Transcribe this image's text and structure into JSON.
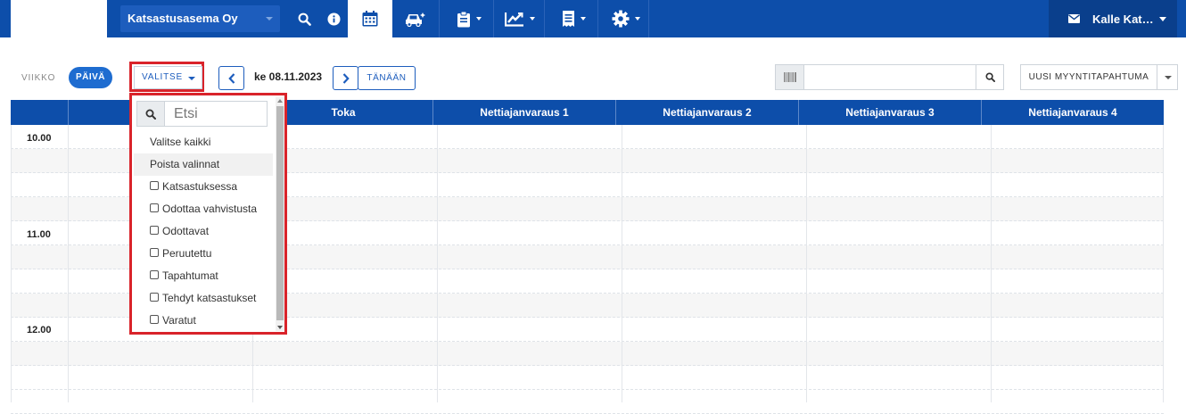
{
  "topbar": {
    "company": "Katsastusasema Oy",
    "user_name": "Kalle Kat…",
    "icons": [
      "search-icon",
      "info-icon",
      "calendar-icon",
      "car-icon",
      "clipboard-icon",
      "chart-icon",
      "receipt-icon",
      "gear-icon",
      "mail-icon"
    ]
  },
  "controls": {
    "week_label": "VIIKKO",
    "day_label": "PÄIVÄ",
    "select_label": "VALITSE",
    "date": "ke 08.11.2023",
    "today_label": "TÄNÄÄN",
    "search_value": "",
    "new_sale_label": "UUSI MYYNTITAPAHTUMA"
  },
  "calendar": {
    "columns": [
      "",
      "Toka",
      "Nettiajanvaraus 1",
      "Nettiajanvaraus 2",
      "Nettiajanvaraus 3",
      "Nettiajanvaraus 4"
    ],
    "times": [
      "10.00",
      "11.00",
      "12.00"
    ]
  },
  "dropdown": {
    "search_placeholder": "Etsi",
    "select_all": "Valitse kaikki",
    "clear": "Poista valinnat",
    "options": [
      "Katsastuksessa",
      "Odottaa vahvistusta",
      "Odottavat",
      "Peruutettu",
      "Tapahtumat",
      "Tehdyt katsastukset",
      "Varatut"
    ]
  },
  "colors": {
    "brand": "#0d4eaa",
    "accent": "#1e6cd0",
    "highlight": "#d9232a"
  }
}
